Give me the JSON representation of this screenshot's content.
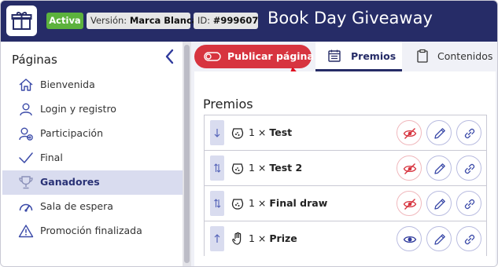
{
  "header": {
    "status_badge": "Activa",
    "version_label": "Versión:",
    "version_value": "Marca Blanca",
    "id_label": "ID:",
    "id_value": "#999607",
    "title": "Book Day Giveaway",
    "logo_icon": "gift-icon"
  },
  "sidebar": {
    "title": "Páginas",
    "collapse_icon": "chevron-left-icon",
    "items": [
      {
        "label": "Bienvenida",
        "icon": "home-icon",
        "active": false
      },
      {
        "label": "Login y registro",
        "icon": "user-icon",
        "active": false
      },
      {
        "label": "Participación",
        "icon": "user-plus-icon",
        "active": false
      },
      {
        "label": "Final",
        "icon": "check-icon",
        "active": false
      },
      {
        "label": "Ganadores",
        "icon": "trophy-icon",
        "active": true
      },
      {
        "label": "Sala de espera",
        "icon": "gauge-icon",
        "active": false
      },
      {
        "label": "Promoción finalizada",
        "icon": "warning-icon",
        "active": false
      }
    ]
  },
  "toolbar": {
    "publish_label": "Publicar página",
    "publish_icon": "toggle-icon",
    "tabs": [
      {
        "label": "Premios",
        "icon": "calendar-icon",
        "active": true
      },
      {
        "label": "Contenidos",
        "icon": "clipboard-icon",
        "active": false
      }
    ]
  },
  "main": {
    "section_title": "Premios",
    "prizes": [
      {
        "qty": "1 ×",
        "name": "Test",
        "icon": "prize-bag-icon",
        "sort_icon": "arrow-down-icon",
        "visibility": "hidden"
      },
      {
        "qty": "1 ×",
        "name": "Test 2",
        "icon": "prize-bag-icon",
        "sort_icon": "arrow-up-down-icon",
        "visibility": "hidden"
      },
      {
        "qty": "1 ×",
        "name": "Final draw",
        "icon": "prize-bag-icon",
        "sort_icon": "arrow-up-down-icon",
        "visibility": "hidden"
      },
      {
        "qty": "1 ×",
        "name": "Prize",
        "icon": "hand-icon",
        "sort_icon": "arrow-up-icon",
        "visibility": "visible"
      }
    ]
  },
  "colors": {
    "header_bg": "#262c67",
    "accent_red": "#d7343f",
    "active_green": "#5cb23d",
    "active_item_bg": "#d9dcef"
  }
}
